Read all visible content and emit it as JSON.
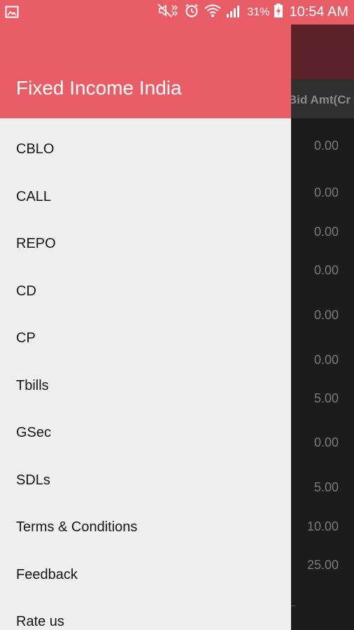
{
  "status_bar": {
    "battery_percent": "31%",
    "time": "10:54 AM",
    "icons": [
      "gallery-notification-icon",
      "mute-icon",
      "alarm-icon",
      "wifi-icon",
      "signal-icon",
      "battery-charging-icon"
    ]
  },
  "drawer": {
    "title": "Fixed Income India",
    "items": [
      {
        "label": "CBLO"
      },
      {
        "label": "CALL"
      },
      {
        "label": "REPO"
      },
      {
        "label": "CD"
      },
      {
        "label": "CP"
      },
      {
        "label": "Tbills"
      },
      {
        "label": "GSec"
      },
      {
        "label": "SDLs"
      },
      {
        "label": "Terms & Conditions"
      },
      {
        "label": "Feedback"
      },
      {
        "label": "Rate us"
      }
    ]
  },
  "background": {
    "column_header": "Bid Amt(Cr",
    "values": [
      "0.00",
      "0.00",
      "0.00",
      "0.00",
      "0.00",
      "0.00",
      "5.00",
      "0.00",
      "5.00",
      "10.00",
      "25.00"
    ]
  },
  "colors": {
    "accent": "#e85d66",
    "toolbar_dim": "#5b2329",
    "drawer_bg": "#efefef"
  }
}
